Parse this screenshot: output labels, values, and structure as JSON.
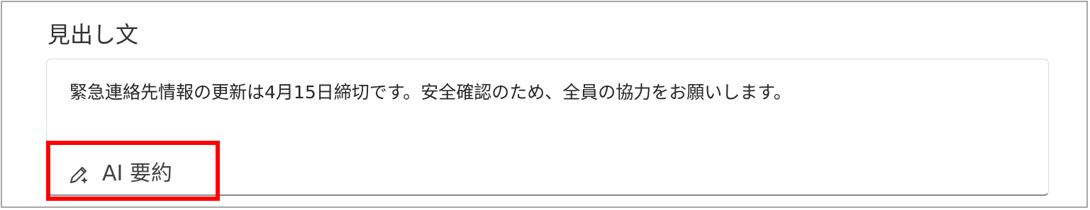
{
  "field": {
    "label": "見出し文",
    "value": "緊急連絡先情報の更新は4月15日締切です。安全確認のため、全員の協力をお願いします。"
  },
  "ai_summary_button": {
    "label": "AI 要約",
    "icon": "pen-sparkle-icon"
  },
  "colors": {
    "highlight": "#ff0000",
    "frame_border": "#a8a8a8",
    "text": "#262626"
  }
}
